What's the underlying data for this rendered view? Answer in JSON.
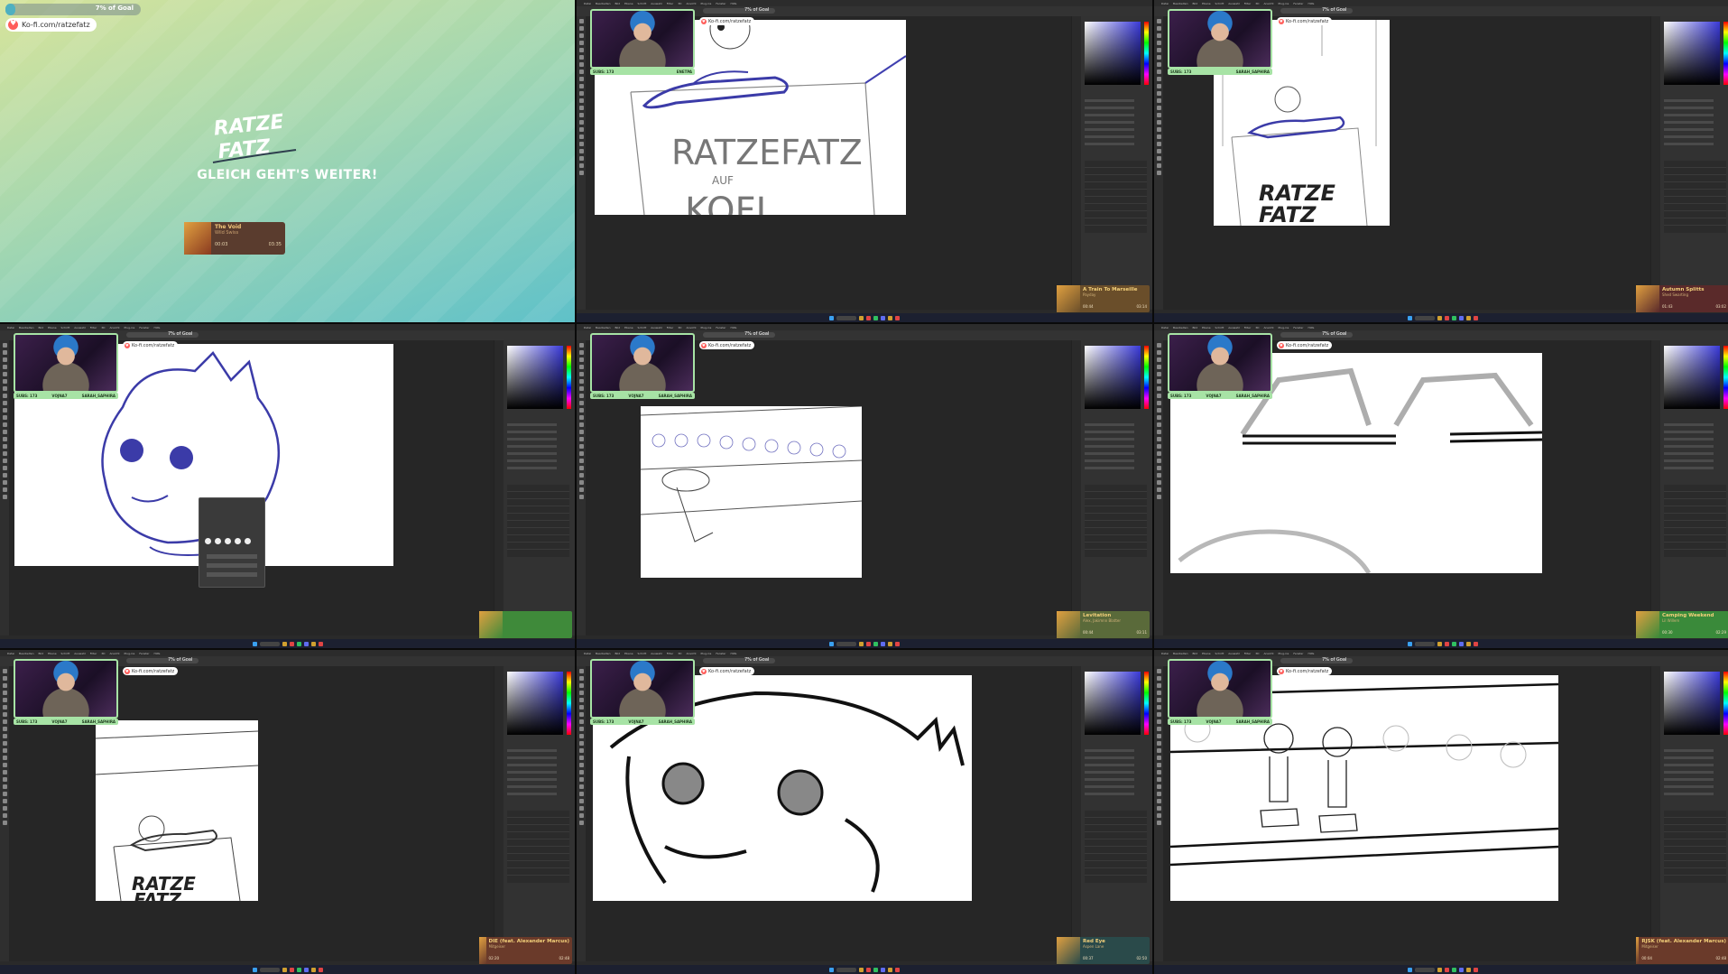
{
  "intermission": {
    "goal_text": "7% of Goal",
    "goal_percent": 7,
    "kofi_url": "Ko-fi.com/ratzefatz",
    "logo_line1": "RATZE",
    "logo_line2": "FATZ",
    "message": "GLEICH GEHT'S WEITER!",
    "music": {
      "title": "The Void",
      "artist": "Wild Swiss",
      "time_start": "00:03",
      "time_end": "03:35"
    },
    "colors": {
      "gradient_start": "#d7e49b",
      "gradient_end": "#5fc1c9",
      "music_bg": "#5a3c2e"
    }
  },
  "overlay": {
    "goal_text": "7% of Goal",
    "kofi_url": "Ko-fi.com/ratzefatz",
    "sub_label_left": "SUBS: 173",
    "sub_label_right": "SARAH_SAPHIRA",
    "accent_color": "#a7e3a5"
  },
  "ps_menu": [
    "Datei",
    "Bearbeiten",
    "Bild",
    "Ebene",
    "Schrift",
    "Auswahl",
    "Filter",
    "3D",
    "Ansicht",
    "Plug-ins",
    "Fenster",
    "Hilfe"
  ],
  "panels": [
    {
      "id": "p2",
      "canvas_title_1": "RATZEFATZ",
      "canvas_title_2": "AUF",
      "canvas_title_3": "KOFI",
      "sub_left": "SUBS: 173",
      "sub_middle": "ENETPA",
      "music": {
        "title": "A Train To Marseille",
        "artist": "Payday",
        "time_start": "00:44",
        "time_end": "03:14",
        "bg": "#6a4e2a"
      }
    },
    {
      "id": "p3",
      "canvas_title_1": "RATZE",
      "canvas_title_2": "FATZ",
      "sub_left": "SUBS: 173",
      "sub_middle": "SARAH_SAPHIRA",
      "music": {
        "title": "Autumn Splitts",
        "artist": "Shed Swarting",
        "time_start": "01:43",
        "time_end": "03:02",
        "bg": "#5a2a2a"
      }
    },
    {
      "id": "p4",
      "sub_left": "SUBS: 173",
      "sub_middle": "VOJNA7",
      "sub_right": "SARAH_SAPHIRA",
      "brush_popup": {
        "title": "Größe:",
        "hardness": "Härte:",
        "items": [
          "Hard Round",
          "Kyle's Ink Box",
          "Kyle's Real Pencil",
          "Kyle's Spatter Brushes"
        ]
      },
      "music": {
        "title": "",
        "artist": "",
        "time_start": "",
        "time_end": "",
        "bg": "#3f8a3a"
      }
    },
    {
      "id": "p5",
      "sub_left": "SUBS: 173",
      "sub_middle": "VOJNA7",
      "sub_right": "SARAH_SAPHIRA",
      "music": {
        "title": "Levitation",
        "artist": "Alex, Jakimnn Blatter",
        "time_start": "00:44",
        "time_end": "03:11",
        "bg": "#5a6a3a"
      }
    },
    {
      "id": "p6",
      "sub_left": "SUBS: 173",
      "sub_middle": "VOJNA7",
      "sub_right": "SARAH_SAPHIRA",
      "music": {
        "title": "Camping Weekend",
        "artist": "Lil Willem",
        "time_start": "00:30",
        "time_end": "02:29",
        "bg": "#3a8a3a"
      }
    },
    {
      "id": "p7",
      "canvas_title_1": "RATZE",
      "canvas_title_2": "FATZ",
      "sub_left": "SUBS: 173",
      "sub_middle": "VOJNA7",
      "sub_right": "SARAH_SAPHIRA",
      "music": {
        "title": "DIE (feat. Alexander Marcus)",
        "artist": "Mitgeiser",
        "time_start": "02:20",
        "time_end": "02:48",
        "bg": "#6a3a2a"
      }
    },
    {
      "id": "p8",
      "sub_left": "SUBS: 173",
      "sub_middle": "VOJNA7",
      "sub_right": "SARAH_SAPHIRA",
      "music": {
        "title": "Red Eye",
        "artist": "Aspen Lane",
        "time_start": "00:37",
        "time_end": "02:50",
        "bg": "#2a4a4a"
      }
    },
    {
      "id": "p9",
      "sub_left": "SUBS: 173",
      "sub_middle": "VOJNA7",
      "sub_right": "SARAH_SAPHIRA",
      "music": {
        "title": "RJSK (feat. Alexander Marcus)",
        "artist": "Mitgeiser",
        "time_start": "00:04",
        "time_end": "02:48",
        "bg": "#6a3a2a"
      }
    }
  ]
}
